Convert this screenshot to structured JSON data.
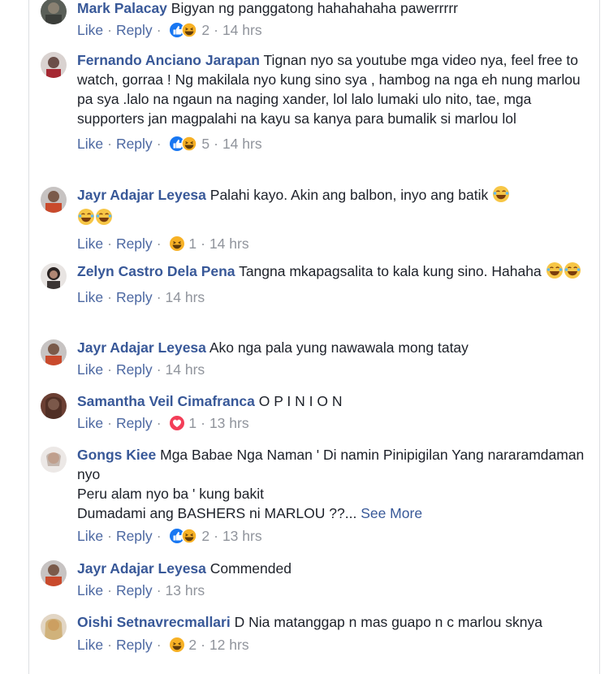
{
  "comments": [
    {
      "name": "Mark Palacay",
      "text": "Bigyan ng panggatong hahahahaha pawerrrrr",
      "like": "Like",
      "reply": "Reply",
      "reactions": [
        "like",
        "haha"
      ],
      "count": "2",
      "time": "14 hrs",
      "avatar": "man-dark"
    },
    {
      "name": "Fernando Anciano Jarapan",
      "text": "Tignan nyo sa youtube mga video nya, feel free to watch, gorraa ! Ng makilala nyo kung sino sya , hambog na nga eh nung marlou pa sya .lalo na ngaun na naging xander, lol lalo lumaki ulo nito, tae, mga supporters jan magpalahi na kayu sa kanya para bumalik si marlou lol",
      "like": "Like",
      "reply": "Reply",
      "reactions": [
        "like",
        "haha"
      ],
      "count": "5",
      "time": "14 hrs",
      "avatar": "man-red"
    },
    {
      "name": "Jayr Adajar Leyesa",
      "text": "Palahi kayo. Akin ang balbon, inyo ang batik",
      "like": "Like",
      "reply": "Reply",
      "reactions": [
        "haha"
      ],
      "count": "1",
      "time": "14 hrs",
      "avatar": "man-blue"
    },
    {
      "name": "Zelyn Castro Dela Pena",
      "text": "Tangna mkapagsalita to kala kung sino. Hahaha",
      "like": "Like",
      "reply": "Reply",
      "reactions": [],
      "count": "",
      "time": "14 hrs",
      "avatar": "woman-dark"
    },
    {
      "name": "Jayr Adajar Leyesa",
      "text": "Ako nga pala yung nawawala mong tatay",
      "like": "Like",
      "reply": "Reply",
      "reactions": [],
      "count": "",
      "time": "14 hrs",
      "avatar": "man-blue"
    },
    {
      "name": "Samantha Veil Cimafranca",
      "text": "O P I N I O N",
      "like": "Like",
      "reply": "Reply",
      "reactions": [
        "love"
      ],
      "count": "1",
      "time": "13 hrs",
      "avatar": "woman-brown"
    },
    {
      "name": "Gongs Kiee",
      "text": "Mga Babae Nga Naman ' Di namin Pinipigilan Yang nararamdaman nyo",
      "line2": "Peru alam nyo ba ' kung bakit",
      "line3": "Dumadami ang BASHERS ni MARLOU ??...",
      "see_more": "See More",
      "like": "Like",
      "reply": "Reply",
      "reactions": [
        "like",
        "haha"
      ],
      "count": "2",
      "time": "13 hrs",
      "avatar": "woman-light"
    },
    {
      "name": "Jayr Adajar Leyesa",
      "text": "Commended",
      "like": "Like",
      "reply": "Reply",
      "reactions": [],
      "count": "",
      "time": "13 hrs",
      "avatar": "man-blue"
    },
    {
      "name": "Oishi Setnavrecmallari",
      "text": "D Nia matanggap n mas guapo n c marlou sknya",
      "like": "Like",
      "reply": "Reply",
      "reactions": [
        "haha"
      ],
      "count": "2",
      "time": "12 hrs",
      "avatar": "woman-blonde"
    }
  ],
  "colors": {
    "name": "#385898",
    "link": "#4b67a1",
    "meta": "#90949c",
    "like": "#1877f2",
    "haha": "#f7b125",
    "love": "#f33e58"
  }
}
